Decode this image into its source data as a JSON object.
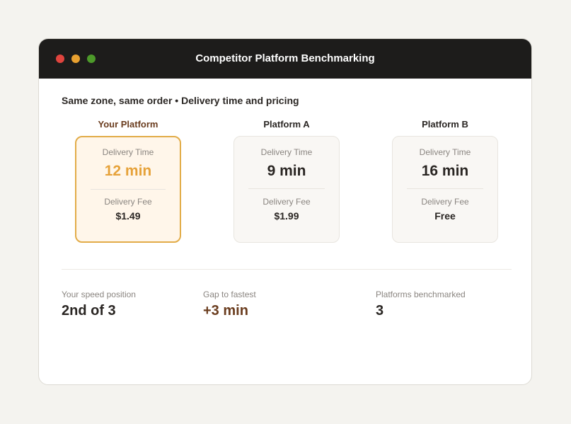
{
  "window": {
    "title": "Competitor Platform Benchmarking"
  },
  "subtitle": "Same zone, same order • Delivery time and pricing",
  "platforms": [
    {
      "name": "Your Platform",
      "time_label": "Delivery Time",
      "time": "12 min",
      "fee_label": "Delivery Fee",
      "fee": "$1.49"
    },
    {
      "name": "Platform A",
      "time_label": "Delivery Time",
      "time": "9 min",
      "fee_label": "Delivery Fee",
      "fee": "$1.99"
    },
    {
      "name": "Platform B",
      "time_label": "Delivery Time",
      "time": "16 min",
      "fee_label": "Delivery Fee",
      "fee": "Free"
    }
  ],
  "stats": {
    "speed_position_label": "Your speed position",
    "speed_position": "2nd of 3",
    "gap_label": "Gap to fastest",
    "gap": "+3 min",
    "benchmarked_label": "Platforms benchmarked",
    "benchmarked": "3"
  },
  "colors": {
    "highlight": "#e6a23a",
    "accent": "#6a3c1e",
    "titlebar": "#1d1c1b"
  }
}
